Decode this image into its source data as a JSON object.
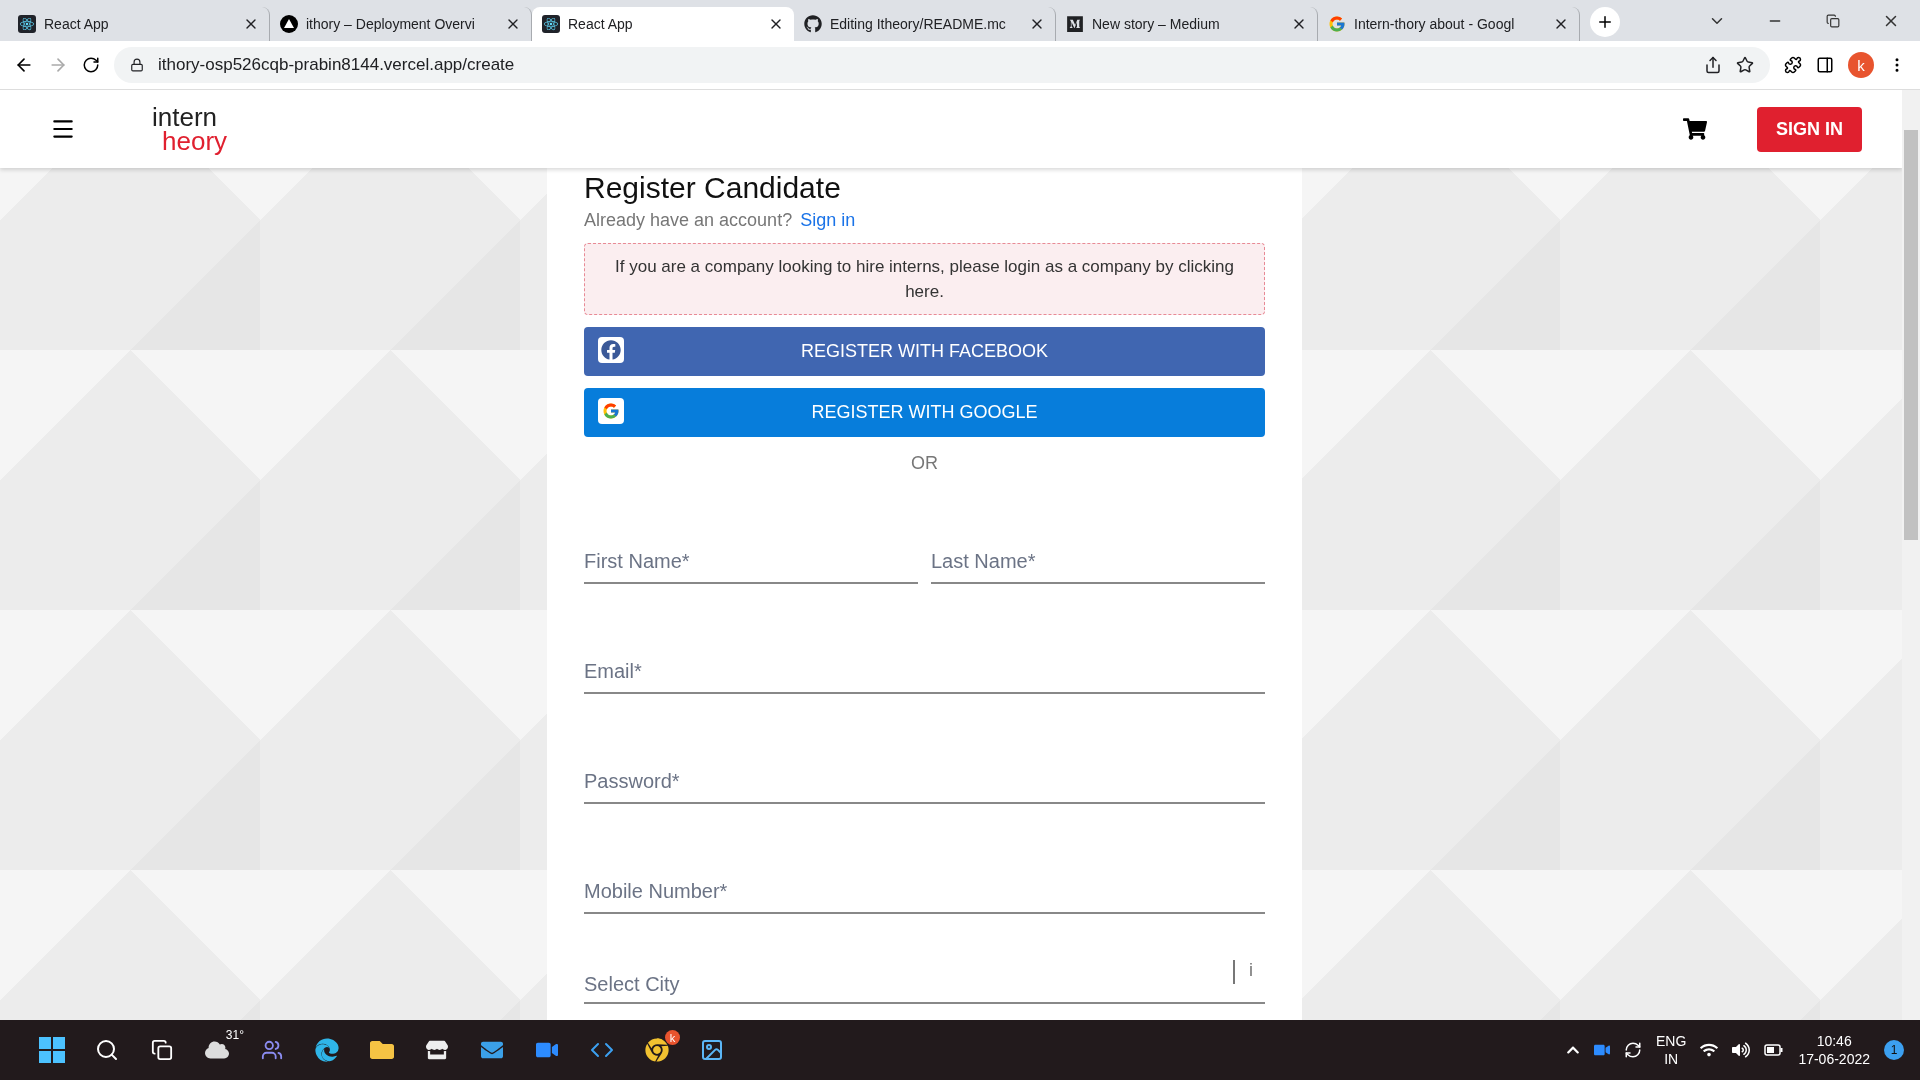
{
  "browser": {
    "tabs": [
      {
        "title": "React App",
        "kind": "react",
        "selected": false
      },
      {
        "title": "ithory – Deployment Overvi",
        "kind": "vercel",
        "selected": false
      },
      {
        "title": "React App",
        "kind": "react",
        "selected": true
      },
      {
        "title": "Editing Itheory/README.mc",
        "kind": "github",
        "selected": false
      },
      {
        "title": "New story – Medium",
        "kind": "medium",
        "selected": false
      },
      {
        "title": "Intern-thory about - Googl",
        "kind": "google",
        "selected": false
      }
    ],
    "address": "ithory-osp526cqb-prabin8144.vercel.app/create",
    "profile": "k"
  },
  "header": {
    "logo_top": "intern",
    "logo_bottom": "heory",
    "sign_in": "SIGN IN"
  },
  "form": {
    "title": "Register Candidate",
    "account_prompt": "Already have an account?",
    "sign_in_link": "Sign in",
    "notice": "If you are a company looking to hire interns, please login as a company by clicking here.",
    "social_buttons": [
      {
        "kind": "facebook",
        "label": "REGISTER WITH FACEBOOK"
      },
      {
        "kind": "google",
        "label": "REGISTER WITH GOOGLE"
      }
    ],
    "divider": "OR",
    "rows": [
      [
        {
          "kind": "text",
          "placeholder": "First Name*"
        },
        {
          "kind": "text",
          "placeholder": "Last Name*"
        }
      ],
      [
        {
          "kind": "text",
          "placeholder": "Email*"
        }
      ],
      [
        {
          "kind": "text",
          "placeholder": "Password*"
        }
      ],
      [
        {
          "kind": "text",
          "placeholder": "Mobile Number*"
        }
      ],
      [
        {
          "kind": "select",
          "placeholder": "Select City",
          "indicator": "i"
        }
      ]
    ]
  },
  "taskbar": {
    "weather": "31°",
    "chrome_badge": "k",
    "language": "ENG",
    "region": "IN",
    "time": "10:46",
    "date": "17-06-2022",
    "notifications": "1"
  }
}
